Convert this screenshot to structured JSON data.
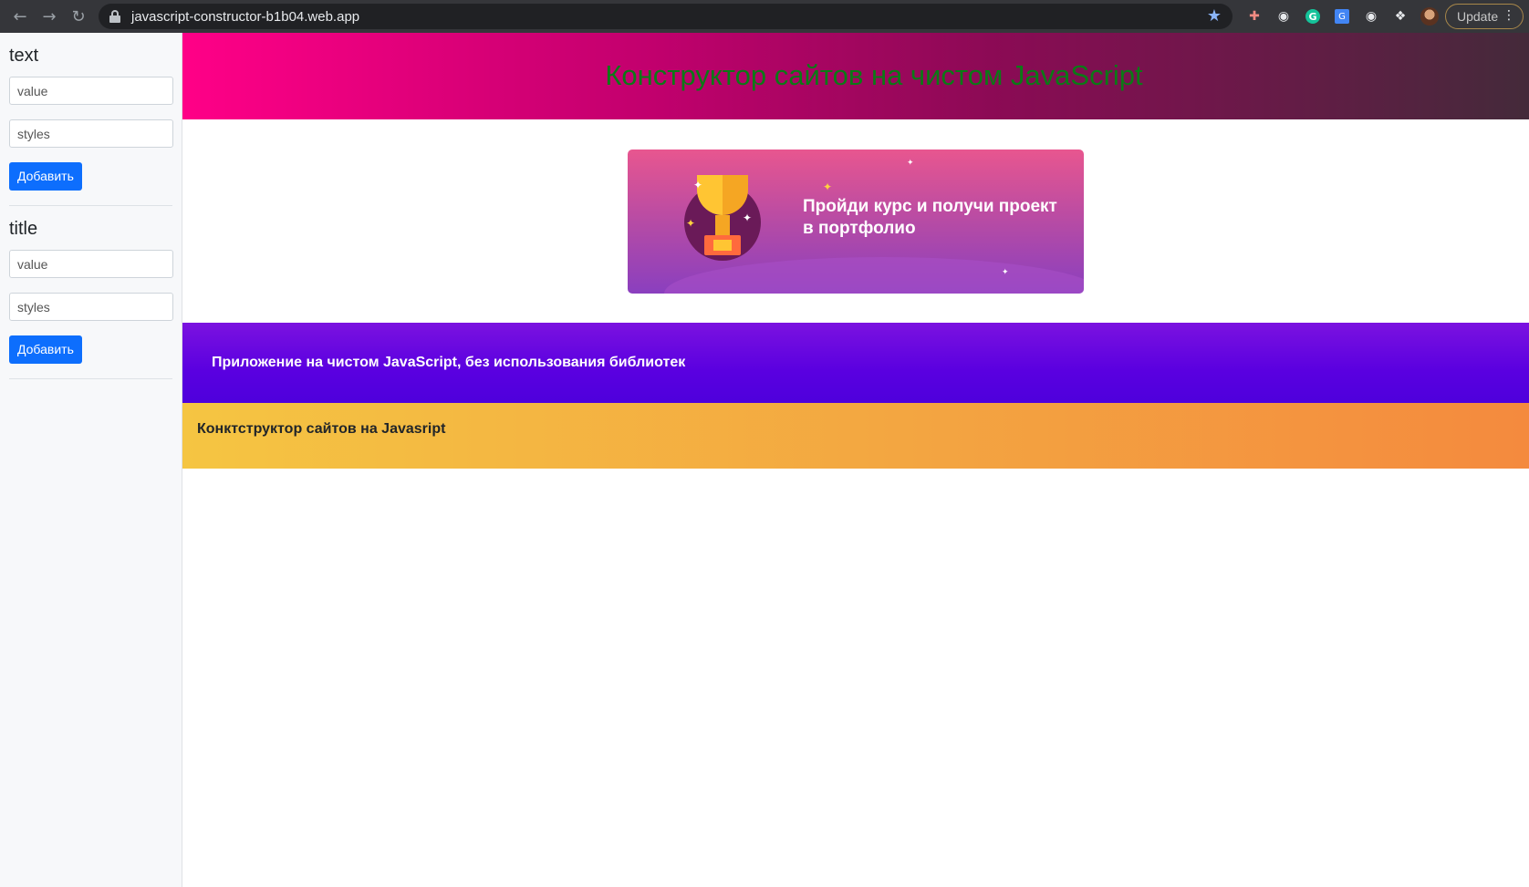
{
  "browser": {
    "url": "javascript-constructor-b1b04.web.app",
    "update_label": "Update"
  },
  "sidebar": {
    "blocks": [
      {
        "title": "text",
        "value_placeholder": "value",
        "styles_placeholder": "styles",
        "button_label": "Добавить"
      },
      {
        "title": "title",
        "value_placeholder": "value",
        "styles_placeholder": "styles",
        "button_label": "Добавить"
      }
    ]
  },
  "main": {
    "header_title": "Конструктор сайтов на чистом JavaScript",
    "banner_text": "Пройди курс и получи проект в портфолио",
    "purple_text": "Приложение на чистом JavaScript, без использования библиотек",
    "orange_text": "Конктструктор сайтов на Javasript"
  },
  "colors": {
    "primary_button": "#0d6efd",
    "header_title_color": "#0b7a16",
    "header_gradient_start": "#ff0087",
    "purple_section": "#5a00e0",
    "orange_section": "#f3a541"
  },
  "icons": [
    "back-icon",
    "forward-icon",
    "reload-icon",
    "lock-icon",
    "star-icon",
    "extensions-icon",
    "menu-dots-icon"
  ]
}
